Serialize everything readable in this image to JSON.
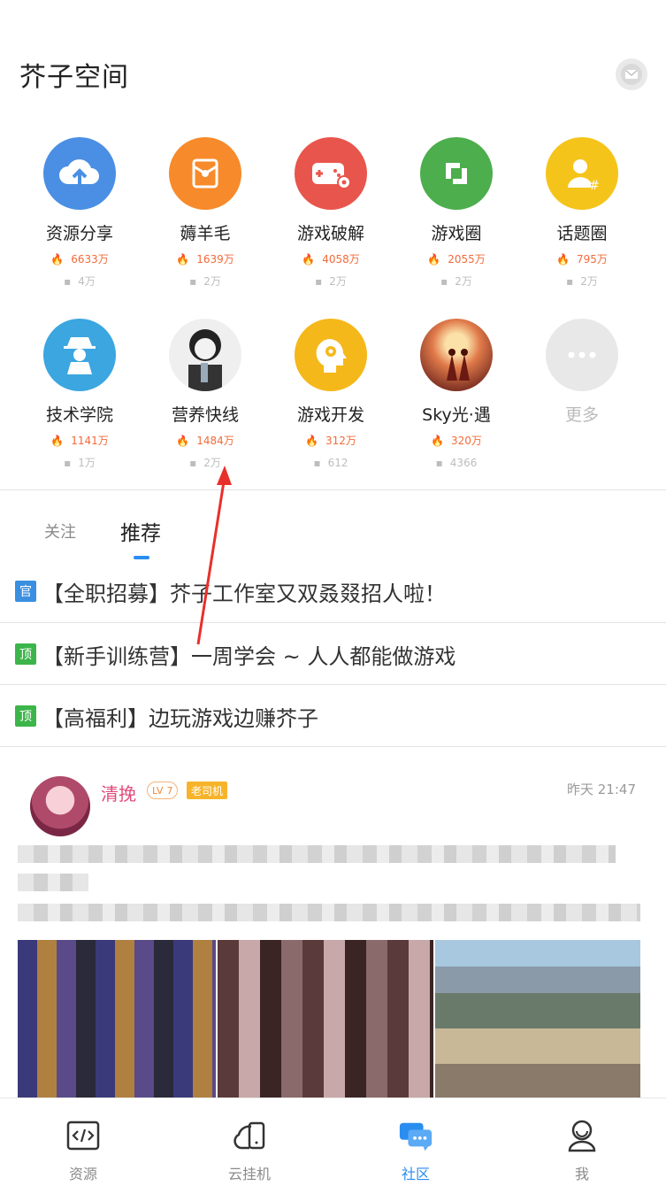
{
  "header": {
    "title": "芥子空间",
    "mail_icon": "mail-icon"
  },
  "grid": [
    {
      "name": "资源分享",
      "hot": "6633万",
      "comments": "4万",
      "icon": "cloud-upload-icon",
      "color": "#4a8fe3"
    },
    {
      "name": "薅羊毛",
      "hot": "1639万",
      "comments": "2万",
      "icon": "red-envelope-icon",
      "color": "#f78a2a"
    },
    {
      "name": "游戏破解",
      "hot": "4058万",
      "comments": "2万",
      "icon": "gamepad-gear-icon",
      "color": "#e8554c"
    },
    {
      "name": "游戏圈",
      "hot": "2055万",
      "comments": "2万",
      "icon": "circle-logo-icon",
      "color": "#4cae4c"
    },
    {
      "name": "话题圈",
      "hot": "795万",
      "comments": "2万",
      "icon": "user-hashtag-icon",
      "color": "#f5c41a"
    },
    {
      "name": "技术学院",
      "hot": "1141万",
      "comments": "1万",
      "icon": "spy-icon",
      "color": "#3ba6e0"
    },
    {
      "name": "营养快线",
      "hot": "1484万",
      "comments": "2万",
      "icon": "meme-photo-icon",
      "color": "#dddddd"
    },
    {
      "name": "游戏开发",
      "hot": "312万",
      "comments": "612",
      "icon": "brain-gear-icon",
      "color": "#f5b81a"
    },
    {
      "name": "Sky光·遇",
      "hot": "320万",
      "comments": "4366",
      "icon": "sky-photo-icon",
      "color": "#c85a3a"
    },
    {
      "name": "更多",
      "icon": "more-dots-icon",
      "color": "#e8e8e8"
    }
  ],
  "tabs": {
    "follow": "关注",
    "recommend": "推荐"
  },
  "notices": [
    {
      "badge": "官",
      "badge_color": "#3a8fe0",
      "text": "【全职招募】芥子工作室又双叒叕招人啦！"
    },
    {
      "badge": "顶",
      "badge_color": "#3cb54a",
      "text": "【新手训练营】一周学会 ~ 人人都能做游戏"
    },
    {
      "badge": "顶",
      "badge_color": "#3cb54a",
      "text": "【高福利】边玩游戏边赚芥子"
    }
  ],
  "post": {
    "user": "清挽",
    "level_prefix": "LV",
    "level": "7",
    "tag": "老司机",
    "time": "昨天 21:47"
  },
  "nav": [
    {
      "label": "资源",
      "icon": "code-icon",
      "active": false
    },
    {
      "label": "云挂机",
      "icon": "cloud-phone-icon",
      "active": false
    },
    {
      "label": "社区",
      "icon": "chat-bubbles-icon",
      "active": true
    },
    {
      "label": "我",
      "icon": "profile-icon",
      "active": false
    }
  ],
  "colors": {
    "accent": "#2a8df0",
    "hot": "#f26b3a",
    "annotation_arrow": "#e8302a"
  }
}
